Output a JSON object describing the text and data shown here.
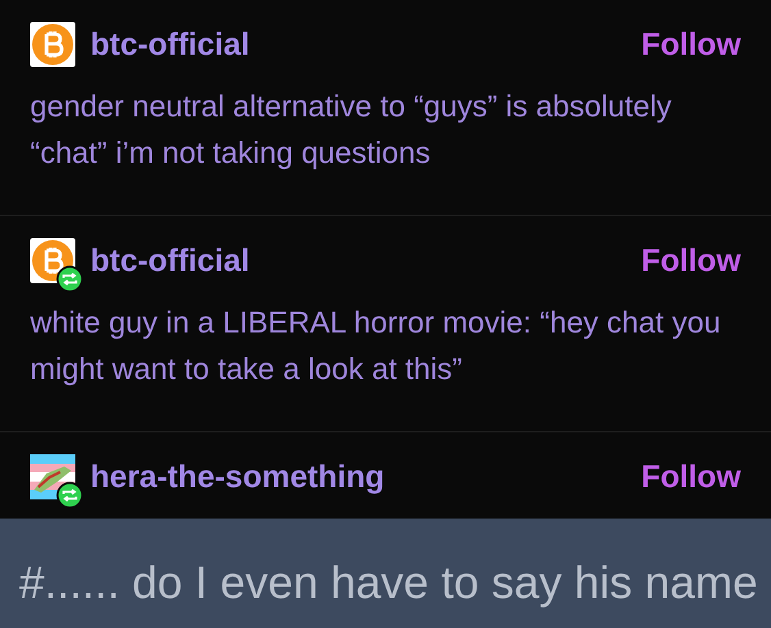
{
  "posts": [
    {
      "username": "btc-official",
      "avatar": {
        "kind": "bitcoin"
      },
      "reblogged": false,
      "follow": "Follow",
      "text": "gender neutral alternative to “guys” is absolutely “chat” i’m not taking questions"
    },
    {
      "username": "btc-official",
      "avatar": {
        "kind": "bitcoin"
      },
      "reblogged": true,
      "follow": "Follow",
      "text": "white guy in a LIBERAL horror movie: “hey chat you might want to take a look at this”"
    },
    {
      "username": "hera-the-something",
      "reblogged": true,
      "follow": "Follow"
    }
  ],
  "tag_panel": {
    "tag": "#...... do I even have to say his name"
  }
}
